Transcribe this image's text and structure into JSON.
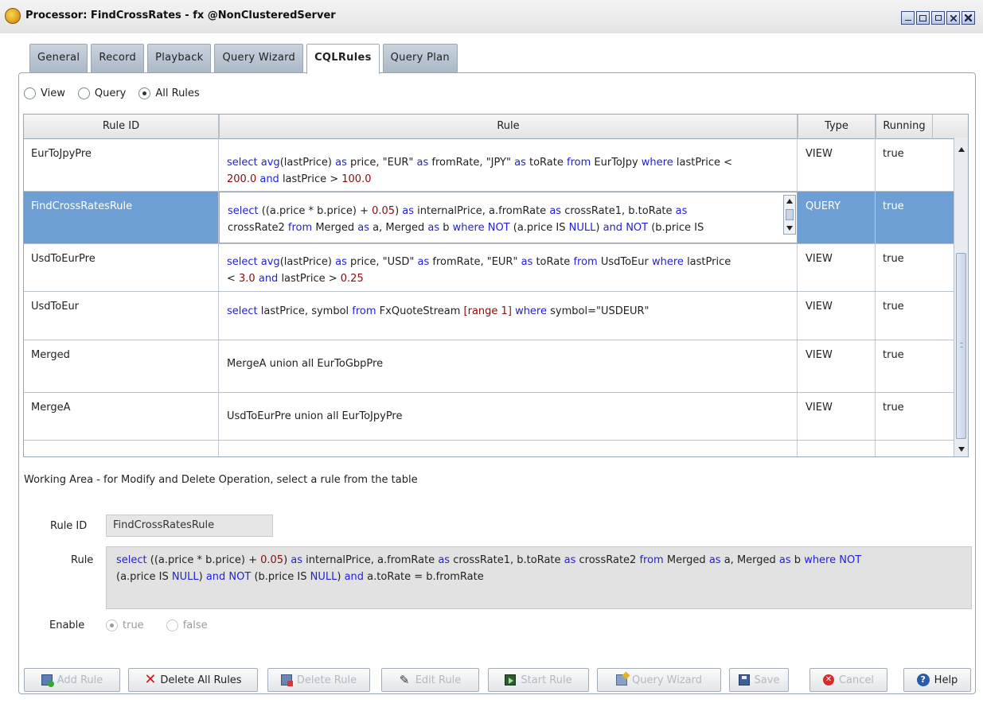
{
  "window": {
    "title": "Processor: FindCrossRates - fx @NonClusteredServer"
  },
  "tabs": [
    {
      "label": "General"
    },
    {
      "label": "Record"
    },
    {
      "label": "Playback"
    },
    {
      "label": "Query Wizard"
    },
    {
      "label": "CQLRules",
      "active": true
    },
    {
      "label": "Query Plan"
    }
  ],
  "filter": {
    "options": [
      {
        "label": "View",
        "selected": false
      },
      {
        "label": "Query",
        "selected": false
      },
      {
        "label": "All Rules",
        "selected": true
      }
    ]
  },
  "table": {
    "columns": [
      "Rule ID",
      "Rule",
      "Type",
      "Running"
    ],
    "rows": [
      {
        "id": "EurToJpyPre",
        "type": "VIEW",
        "running": "true"
      },
      {
        "id": "FindCrossRatesRule",
        "type": "QUERY",
        "running": "true",
        "selected": true
      },
      {
        "id": "UsdToEurPre",
        "type": "VIEW",
        "running": "true"
      },
      {
        "id": "UsdToEur",
        "type": "VIEW",
        "running": "true"
      },
      {
        "id": "Merged",
        "type": "VIEW",
        "running": "true"
      },
      {
        "id": "MergeA",
        "type": "VIEW",
        "running": "true"
      }
    ],
    "rules_text": {
      "r0_l1": [
        "select",
        " avg",
        "(lastPrice) ",
        "as",
        " price, \"EUR\" ",
        "as",
        " fromRate, \"JPY\" ",
        "as",
        " toRate ",
        "from",
        " EurToJpy ",
        "where",
        " lastPrice <"
      ],
      "r0_l2": [
        "200.0",
        " and",
        " lastPrice > ",
        "100.0"
      ],
      "r1_l1": [
        "select",
        " ((a.price * b.price) + ",
        "0.05",
        ") ",
        "as",
        " internalPrice, a.fromRate ",
        "as",
        " crossRate1, b.toRate ",
        "as"
      ],
      "r1_l2": [
        "crossRate2 ",
        "from",
        " Merged ",
        "as",
        " a, Merged ",
        "as",
        " b ",
        "where",
        " NOT",
        " (a.price IS ",
        "NULL",
        ") ",
        "and",
        " NOT",
        " (b.price IS"
      ],
      "r2_l1": [
        "select",
        " avg",
        "(lastPrice) ",
        "as",
        " price, \"USD\" ",
        "as",
        " fromRate, \"EUR\" ",
        "as",
        " toRate ",
        "from",
        " UsdToEur ",
        "where",
        " lastPrice"
      ],
      "r2_l2": [
        "< ",
        "3.0",
        " and",
        " lastPrice > ",
        "0.25"
      ],
      "r3_l1": [
        "select",
        " lastPrice, symbol ",
        "from",
        " FxQuoteStream ",
        "[",
        "range 1",
        "] ",
        "where",
        " symbol=\"USDEUR\""
      ],
      "r4_l1": [
        "MergeA union all EurToGbpPre"
      ],
      "r5_l1": [
        "UsdToEurPre union all EurToJpyPre"
      ]
    }
  },
  "working_area": {
    "label": "Working Area - for Modify and Delete Operation, select a rule from the table",
    "rule_id_label": "Rule ID",
    "rule_id_value": "FindCrossRatesRule",
    "rule_label": "Rule",
    "rule_l1": [
      "select",
      " ((a.price * b.price) + ",
      "0.05",
      ") ",
      "as",
      " internalPrice, a.fromRate ",
      "as",
      " crossRate1, b.toRate ",
      "as",
      " crossRate2 ",
      "from",
      " Merged ",
      "as",
      " a, Merged ",
      "as",
      " b ",
      "where",
      " NOT"
    ],
    "rule_l2": [
      "(a.price IS ",
      "NULL",
      ") ",
      "and",
      " NOT",
      " (b.price IS ",
      "NULL",
      ") ",
      "and",
      " a.toRate = b.fromRate"
    ],
    "enable_label": "Enable",
    "enable_true": "true",
    "enable_false": "false",
    "enable_value": "true"
  },
  "buttons": {
    "add_rule": "Add Rule",
    "delete_all_rules": "Delete All Rules",
    "delete_rule": "Delete Rule",
    "edit_rule": "Edit Rule",
    "start_rule": "Start Rule",
    "query_wizard": "Query Wizard",
    "save": "Save",
    "cancel": "Cancel",
    "help": "Help"
  },
  "colors": {
    "keyword": "#2222d6",
    "number": "#8b0b0b",
    "selection": "#6d9fd4"
  }
}
